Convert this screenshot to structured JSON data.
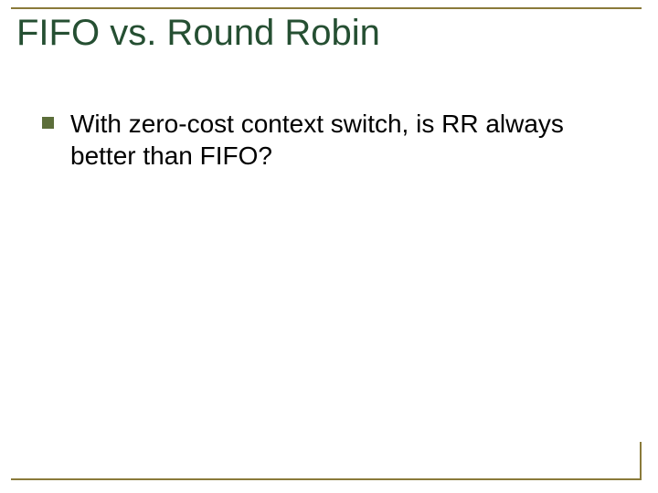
{
  "colors": {
    "rule": "#8a7a3a",
    "title": "#254f32",
    "bullet": "#5c6e3a",
    "body": "#000000"
  },
  "title": "FIFO vs. Round Robin",
  "bullets": [
    {
      "text": "With zero-cost context switch, is RR always better than FIFO?"
    }
  ]
}
